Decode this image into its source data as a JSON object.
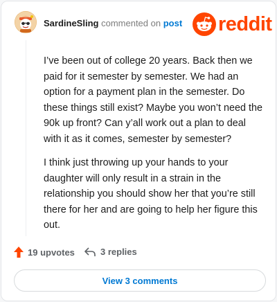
{
  "header": {
    "username": "SardineSling",
    "action": "commented on",
    "post_link": "post",
    "brand": "reddit"
  },
  "comment": {
    "paragraphs": [
      "I’ve been out of college 20 years. Back then we paid for it semester by semester. We had an option for a payment plan in the semester. Do these things still exist? Maybe you won’t need the 90k up front? Can y’all work out a plan to deal with it as it comes, semester by semester?",
      "I think just throwing up your hands to your daughter will only result in a strain in the relationship you should show her that you’re still there for her and are going to help her figure this out."
    ]
  },
  "footer": {
    "upvotes": "19 upvotes",
    "replies": "3 replies",
    "view_button": "View 3 comments"
  },
  "colors": {
    "brand": "#ff4500",
    "link": "#0079d3",
    "muted": "#7c7c7c"
  },
  "icons": {
    "upvote": "upvote-arrow-icon",
    "reply": "reply-arrow-icon",
    "avatar": "snoo-avatar",
    "logo": "reddit-snoo-icon"
  }
}
